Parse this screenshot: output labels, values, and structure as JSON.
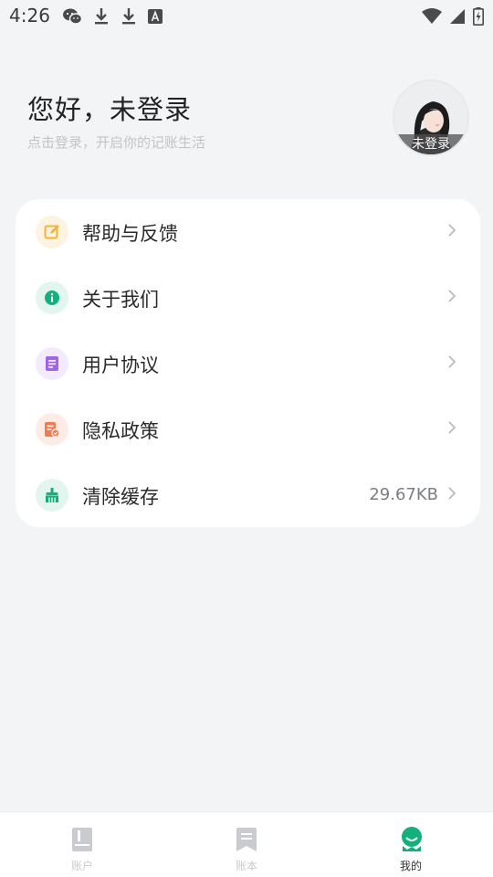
{
  "status_bar": {
    "time": "4:26",
    "left_icons": [
      "wechat-icon",
      "download-icon",
      "download-icon",
      "font-a-icon"
    ],
    "right_icons": [
      "wifi-icon",
      "signal-icon",
      "battery-charging-icon"
    ]
  },
  "header": {
    "greeting": "您好，未登录",
    "subtitle": "点击登录，开启你的记账生活",
    "avatar_badge": "未登录"
  },
  "menu": {
    "items": [
      {
        "label": "帮助与反馈",
        "icon": "edit-note-icon",
        "color": "#f4b23c",
        "bg": "#fdf3e1",
        "value": ""
      },
      {
        "label": "关于我们",
        "icon": "info-icon",
        "color": "#13b07b",
        "bg": "#e2f5ee",
        "value": ""
      },
      {
        "label": "用户协议",
        "icon": "document-icon",
        "color": "#a064e6",
        "bg": "#f3ebfd",
        "value": ""
      },
      {
        "label": "隐私政策",
        "icon": "privacy-document-icon",
        "color": "#f07a52",
        "bg": "#fdece6",
        "value": ""
      },
      {
        "label": "清除缓存",
        "icon": "broom-icon",
        "color": "#13b07b",
        "bg": "#e2f5ee",
        "value": "29.67KB"
      }
    ]
  },
  "tabbar": {
    "tabs": [
      {
        "label": "账户",
        "icon": "book-icon",
        "active": false
      },
      {
        "label": "账本",
        "icon": "bookmark-icon",
        "active": false
      },
      {
        "label": "我的",
        "icon": "smiley-user-icon",
        "active": true
      }
    ],
    "active_color": "#13b07b",
    "inactive_color": "#c9cbce"
  }
}
